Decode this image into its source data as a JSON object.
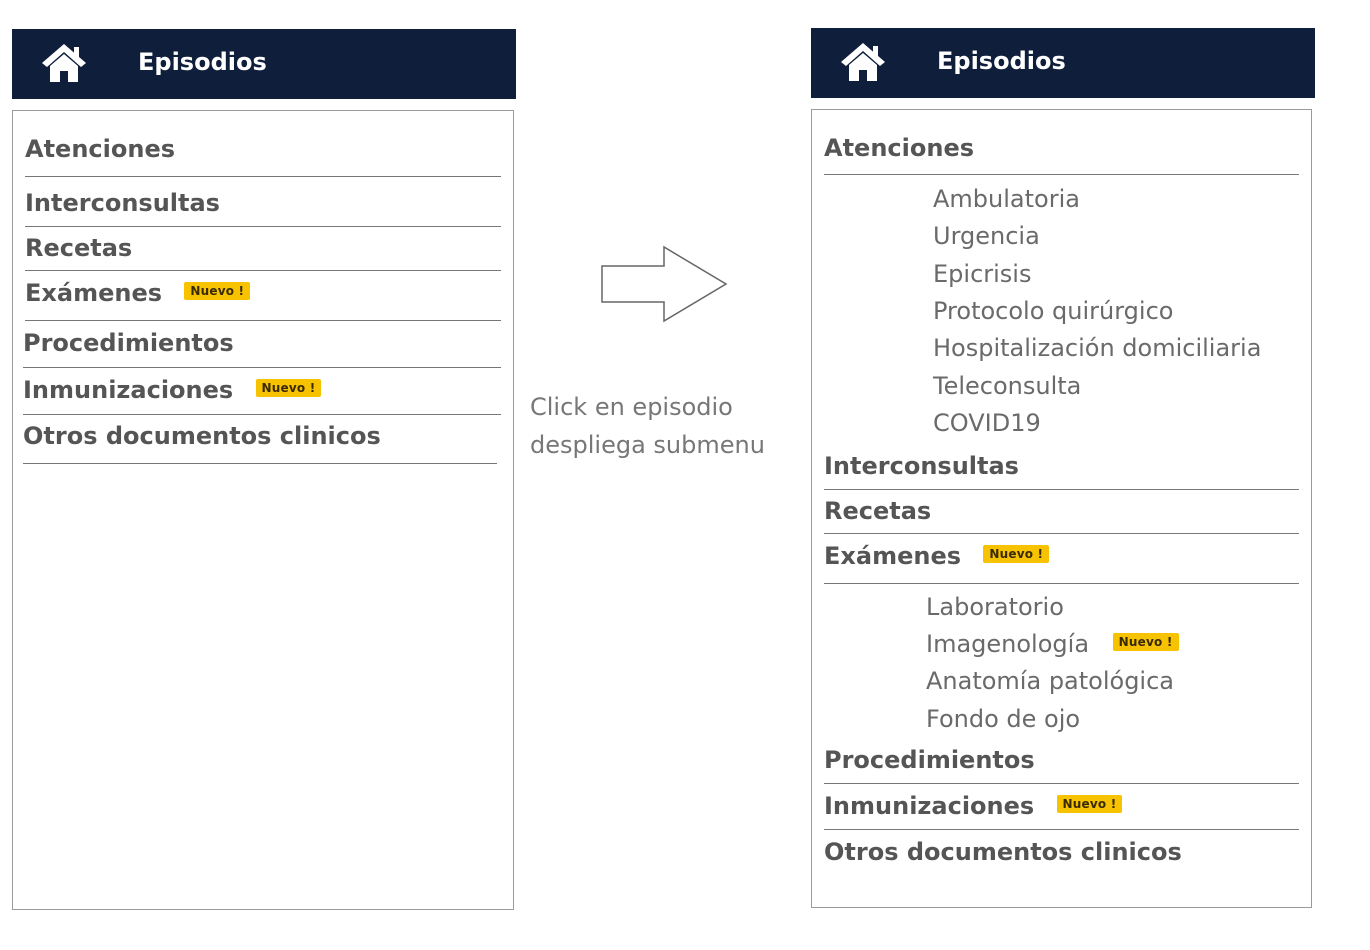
{
  "left": {
    "header_title": "Episodios",
    "header_icon": "home-icon",
    "items": [
      {
        "label": "Atenciones"
      },
      {
        "label": "Interconsultas"
      },
      {
        "label": "Recetas"
      },
      {
        "label": "Exámenes",
        "badge": "Nuevo !"
      },
      {
        "label": "Procedimientos"
      },
      {
        "label": "Inmunizaciones",
        "badge": "Nuevo !"
      },
      {
        "label": "Otros documentos clinicos"
      }
    ]
  },
  "caption": {
    "line1": "Click en episodio",
    "line2": "despliega submenu"
  },
  "arrow_icon": "right-arrow-icon",
  "right": {
    "header_title": "Episodios",
    "header_icon": "home-icon",
    "atenciones": {
      "label": "Atenciones",
      "subitems": [
        "Ambulatoria",
        "Urgencia",
        "Epicrisis",
        "Protocolo quirúrgico",
        "Hospitalización domiciliaria",
        "Teleconsulta",
        "COVID19"
      ]
    },
    "interconsultas": {
      "label": "Interconsultas"
    },
    "recetas": {
      "label": "Recetas"
    },
    "examenes": {
      "label": "Exámenes",
      "badge": "Nuevo !",
      "subitems": [
        {
          "label": "Laboratorio"
        },
        {
          "label": "Imagenología",
          "badge": "Nuevo !"
        },
        {
          "label": "Anatomía patológica"
        },
        {
          "label": "Fondo de ojo"
        }
      ]
    },
    "procedimientos": {
      "label": "Procedimientos"
    },
    "inmunizaciones": {
      "label": "Inmunizaciones",
      "badge": "Nuevo !"
    },
    "otros": {
      "label": "Otros documentos clinicos"
    }
  },
  "colors": {
    "header_bg": "#0f1e3a",
    "badge_bg": "#f7c200",
    "text": "#555555"
  }
}
